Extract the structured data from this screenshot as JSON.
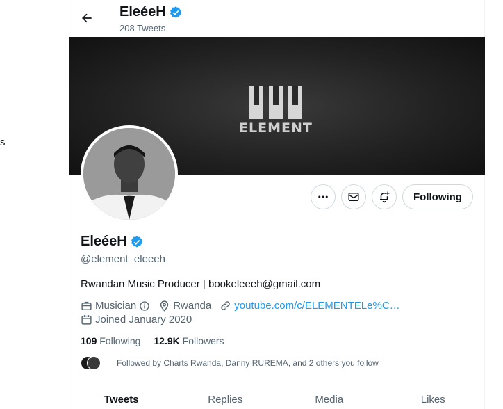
{
  "left_rail": {
    "fragment": "s"
  },
  "header": {
    "name": "EleéeH",
    "tweet_count": "208 Tweets"
  },
  "banner": {
    "brand_text": "ELEMENT"
  },
  "actions": {
    "more_icon": "more-icon",
    "message_icon": "envelope-icon",
    "notify_icon": "bell-plus-icon",
    "follow_label": "Following"
  },
  "profile": {
    "name": "EleéeH",
    "handle": "@element_eleeeh",
    "bio": "Rwandan Music Producer | bookeleeeh@gmail.com",
    "category": "Musician",
    "location": "Rwanda",
    "website": "youtube.com/c/ELEMENTELe%C…",
    "joined": "Joined January 2020",
    "verified_color": "#1d9bf0"
  },
  "stats": {
    "following_count": "109",
    "following_label": "Following",
    "followers_count": "12.9K",
    "followers_label": "Followers"
  },
  "followed_by": "Followed by Charts Rwanda, Danny RUREMA, and 2 others you follow",
  "tabs": [
    {
      "label": "Tweets",
      "active": true
    },
    {
      "label": "Replies",
      "active": false
    },
    {
      "label": "Media",
      "active": false
    },
    {
      "label": "Likes",
      "active": false
    }
  ]
}
